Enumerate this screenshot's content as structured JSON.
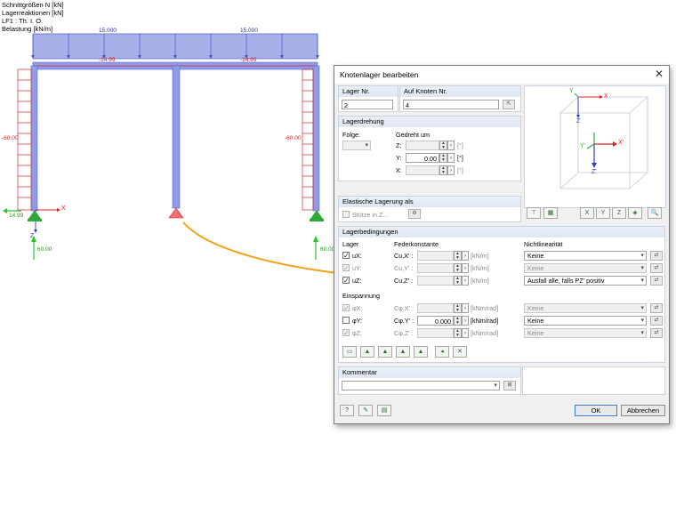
{
  "info": {
    "lines": [
      "Schnittgrößen N [kN]",
      "Lagerreaktionen [kN]",
      "LF1 : Th. I. O.",
      "Belastung [kN/m]"
    ]
  },
  "model": {
    "load_left": "15.000",
    "load_right": "15.000",
    "beam_left": "-14.99",
    "beam_right": "-14.99",
    "col_left_force": "-60.00",
    "col_right_force": "-60.00",
    "reaction_left_h": "14.99",
    "reaction_left_v": "60.00",
    "reaction_right_v": "60.00",
    "axis_x": "X",
    "axis_z": "Z"
  },
  "dialog": {
    "title": "Knotenlager bearbeiten",
    "lager_nr_label": "Lager Nr.",
    "lager_nr_value": "2",
    "auf_knoten_label": "Auf Knoten Nr.",
    "auf_knoten_value": "4",
    "lagerdrehung": {
      "header": "Lagerdrehung",
      "folge_label": "Folge:",
      "gedreht_label": "Gedreht um",
      "z_label": "Z:",
      "y_label": "Y:",
      "x_label": "X:",
      "z_value": "",
      "y_value": "0.00",
      "x_value": "",
      "unit": "[°]"
    },
    "elastische": {
      "header": "Elastische Lagerung als",
      "stuetze_label": "Stütze in Z..."
    },
    "lagerbedingungen": {
      "header": "Lagerbedingungen",
      "lager_col": "Lager",
      "feder_col": "Federkonstante",
      "nichtlin_col": "Nichtlinearität",
      "rows": [
        {
          "label": "uX:",
          "c_label": "Cu,X' :",
          "value": "",
          "unit": "[kN/m]",
          "nonlin": "Keine",
          "checked": "✓"
        },
        {
          "label": "uY:",
          "c_label": "Cu,Y' :",
          "value": "",
          "unit": "[kN/m]",
          "nonlin": "Keine",
          "checked": "✓"
        },
        {
          "label": "uZ:",
          "c_label": "Cu,Z' :",
          "value": "",
          "unit": "[kN/m]",
          "nonlin": "Ausfall alle, falls PZ' positiv",
          "checked": "✓"
        }
      ],
      "einspannung_label": "Einspannung",
      "rot_rows": [
        {
          "label": "φX:",
          "c_label": "Cφ,X' :",
          "value": "",
          "unit": "[kNm/rad]",
          "nonlin": "Keine",
          "checked": "✓"
        },
        {
          "label": "φY:",
          "c_label": "Cφ,Y' :",
          "value": "0.000",
          "unit": "[kNm/rad]",
          "nonlin": "Keine",
          "checked": ""
        },
        {
          "label": "φZ:",
          "c_label": "Cφ,Z' :",
          "value": "",
          "unit": "[kNm/rad]",
          "nonlin": "Keine",
          "checked": "✓"
        }
      ]
    },
    "kommentar_header": "Kommentar",
    "kommentar_value": "",
    "ok_label": "OK",
    "cancel_label": "Abbrechen",
    "view_axes": {
      "x": "X",
      "y": "Y",
      "z": "Z",
      "x2": "X'",
      "y2": "Y'",
      "z2": "Z'"
    }
  },
  "colors": {
    "member": "#8e9be6",
    "member_dark": "#5d6cd4",
    "load": "#8a92e0",
    "support": "#2fa83a",
    "force_red": "#d8232a",
    "arrow_orange": "#f5a21b",
    "reaction_green": "#2cc52c"
  }
}
